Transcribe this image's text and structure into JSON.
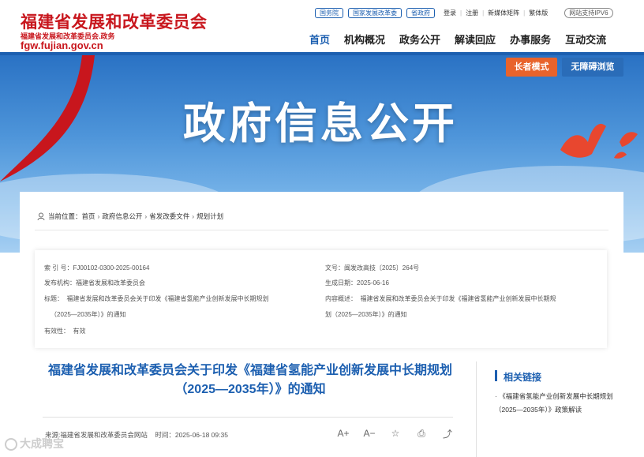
{
  "header": {
    "logo_title": "福建省发展和改革委员会",
    "logo_subtitle": "福建省发展和改革委员会.政务",
    "logo_url": "fgw.fujian.gov.cn",
    "top_pills": [
      "国务院",
      "国家发展改革委",
      "省政府"
    ],
    "top_links": [
      "登录",
      "注册",
      "新媒体矩阵",
      "繁体版"
    ],
    "ipv6_badge": "网站支持IPV6",
    "nav": [
      "首页",
      "机构概况",
      "政务公开",
      "解读回应",
      "办事服务",
      "互动交流"
    ],
    "active_nav": "首页"
  },
  "banner": {
    "title": "政府信息公开",
    "elder_mode_button": "长者模式",
    "accessible_button": "无障碍浏览"
  },
  "breadcrumb": {
    "prefix": "当前位置：",
    "items": [
      "首页",
      "政府信息公开",
      "省发改委文件",
      "规划计划"
    ]
  },
  "info": {
    "index_label": "索 引 号：",
    "index_value": "FJ00102-0300-2025-00164",
    "docno_label": "文号：",
    "docno_value": "闽发改高技〔2025〕264号",
    "issuer_label": "发布机构：",
    "issuer_value": "福建省发展和改革委员会",
    "date_label": "生成日期：",
    "date_value": "2025-06-16",
    "title_label": "标题：",
    "title_value_1": "福建省发展和改革委员会关于印发《福建省氢能产业创新发展中长期规划",
    "title_value_2": "（2025—2035年）》的通知",
    "summary_label": "内容概述：",
    "summary_value_1": "福建省发展和改革委员会关于印发《福建省氢能产业创新发展中长期规",
    "summary_value_2": "划（2025—2035年）》的通知",
    "validity_label": "有效性：",
    "validity_value": "有效"
  },
  "article": {
    "title": "福建省发展和改革委员会关于印发《福建省氢能产业创新发展中长期规划（2025—2035年）》的通知",
    "source": "来源:福建省发展和改革委员会网站",
    "time_label": "时间：",
    "time_value": "2025-06-18 09:35"
  },
  "tools": [
    "A+",
    "A−",
    "☆",
    "⎙",
    "⤴"
  ],
  "related": {
    "title": "相关链接",
    "item": "· 《福建省氢能产业创新发展中长期规划（2025—2035年）》政策解读"
  },
  "watermark": "大成聘宝",
  "colors": {
    "brand_red": "#c8161d",
    "brand_blue": "#1c5fb0",
    "elder_orange": "#e8632b"
  }
}
